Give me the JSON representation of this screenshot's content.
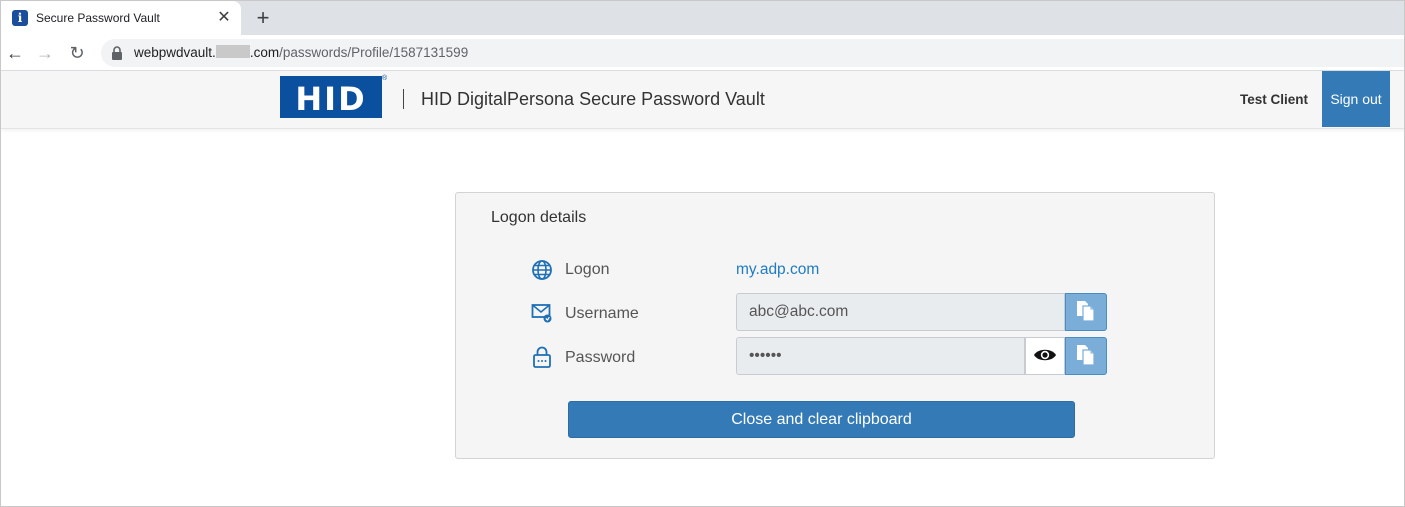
{
  "browser": {
    "tab_title": "Secure Password Vault",
    "tab_close": "✕",
    "new_tab": "+",
    "back": "←",
    "forward": "→",
    "reload": "↻",
    "url_host_prefix": "webpwdvault.",
    "url_host_suffix": ".com",
    "url_path": "/passwords/Profile/1587131599"
  },
  "header": {
    "logo_text": "HID",
    "logo_registered": "®",
    "app_title": "HID DigitalPersona Secure Password Vault",
    "user_name": "Test Client",
    "signout_label": "Sign out"
  },
  "panel": {
    "title": "Logon details",
    "logon_label": "Logon",
    "logon_value": "my.adp.com",
    "username_label": "Username",
    "username_value": "abc@abc.com",
    "password_label": "Password",
    "password_value": "••••••",
    "close_button_label": "Close and clear clipboard"
  },
  "colors": {
    "accent": "#337ab7",
    "brand": "#0b4f9f",
    "link": "#1f7bc2",
    "icon": "#1f6fb5"
  },
  "icons": {
    "logon": "globe-icon",
    "username": "mail-icon",
    "password": "lock-icon",
    "reveal": "eye-icon",
    "copy": "copy-icon"
  }
}
